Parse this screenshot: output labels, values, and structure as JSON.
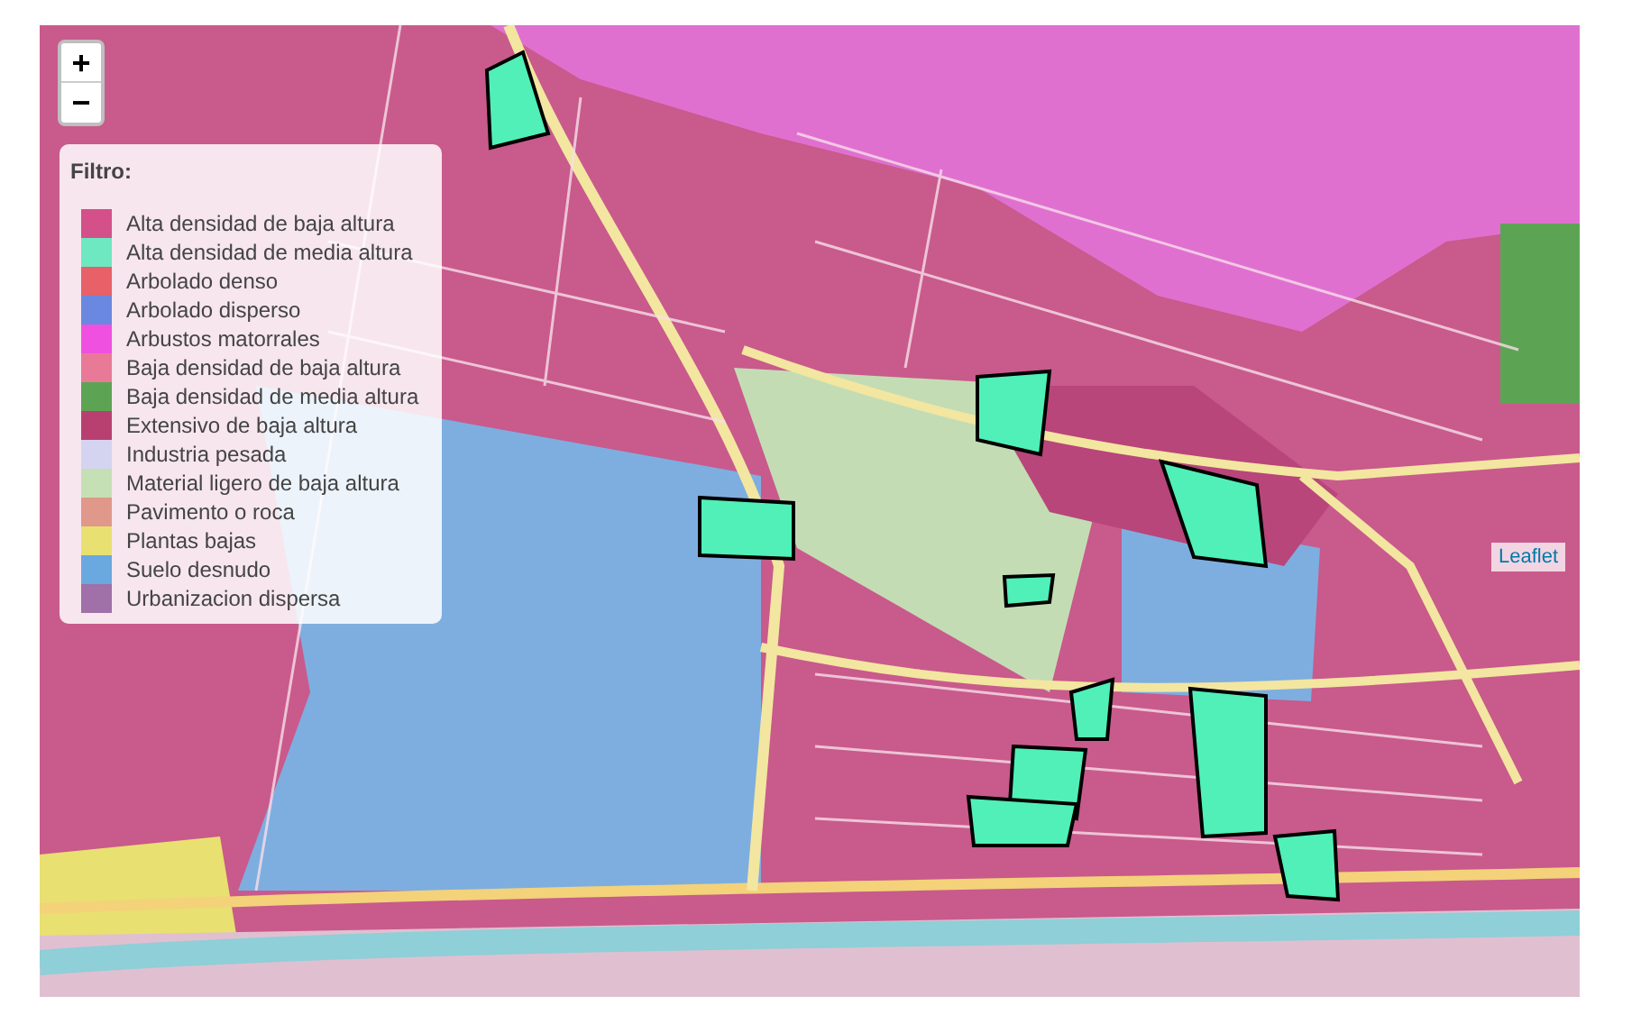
{
  "map": {
    "zoom_controls": [
      {
        "kind": "zoom-in",
        "label": "+"
      },
      {
        "kind": "zoom-out",
        "label": "−"
      }
    ],
    "legend": {
      "title": "Filtro:",
      "items": [
        {
          "label": "Alta densidad de baja altura",
          "color": "#d4508a"
        },
        {
          "label": "Alta densidad de media altura",
          "color": "#6ee8c0"
        },
        {
          "label": "Arbolado denso",
          "color": "#e86068"
        },
        {
          "label": "Arbolado disperso",
          "color": "#6a88e0"
        },
        {
          "label": "Arbustos matorrales",
          "color": "#f050e0"
        },
        {
          "label": "Baja densidad de baja altura",
          "color": "#e87a98"
        },
        {
          "label": "Baja densidad de media altura",
          "color": "#5ca454"
        },
        {
          "label": "Extensivo de baja altura",
          "color": "#b84070"
        },
        {
          "label": "Industria pesada",
          "color": "#d4d4f0"
        },
        {
          "label": "Material ligero de baja altura",
          "color": "#c4e0b4"
        },
        {
          "label": "Pavimento o roca",
          "color": "#e0988a"
        },
        {
          "label": "Plantas bajas",
          "color": "#e8e070"
        },
        {
          "label": "Suelo desnudo",
          "color": "#6aa8e0"
        },
        {
          "label": "Urbanizacion dispersa",
          "color": "#a070a8"
        }
      ]
    },
    "attribution": "Leaflet"
  }
}
